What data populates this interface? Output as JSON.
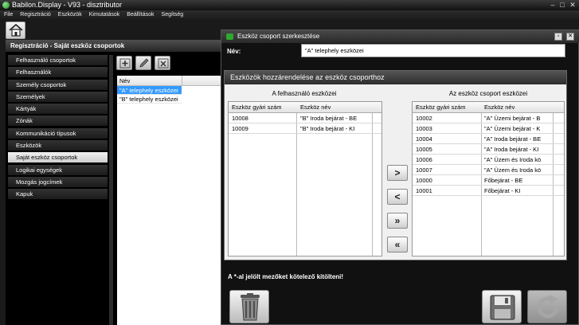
{
  "window": {
    "title": "Babilon.Display - V93 - disztributor",
    "minimize_glyph": "–",
    "maximize_glyph": "□",
    "close_glyph": "✕"
  },
  "menu": [
    "File",
    "Regisztráció",
    "Eszközök",
    "Kimutatások",
    "Beállítások",
    "Segítség"
  ],
  "left_panel": {
    "header": "Regisztráció - Saját eszköz csoportok",
    "items": [
      "Felhasználó csoportok",
      "Felhasználók",
      "Személy csoportok",
      "Személyek",
      "Kártyák",
      "Zónák",
      "Kommunikáció típusok",
      "Eszközök",
      "Saját eszköz csoportok",
      "Logikai egységek",
      "Mozgás jogcímek",
      "Kapuk"
    ],
    "active_item": "Saját eszköz csoportok",
    "toolbar_icons": [
      "add-icon",
      "edit-icon",
      "delete-icon"
    ],
    "table": {
      "header": "Név",
      "rows": [
        "\"A\" telephely eszközei",
        "\"B\" telephely eszközei"
      ],
      "selected_index": 0
    }
  },
  "dialog": {
    "title": "Eszköz csoport szerkesztése",
    "min_glyph": "▫",
    "close_glyph": "✕",
    "name_label": "Név:",
    "name_value": "\"A\" telephely eszközei",
    "assign_title": "Eszközök hozzárendelése az eszköz csoporthoz",
    "left_label": "A felhasználó eszközei",
    "right_label": "Az eszköz csoport eszközei",
    "columns": [
      "Eszköz gyári szám",
      "Eszköz név"
    ],
    "left_rows": [
      {
        "serial": "10008",
        "name": "\"B\" Iroda bejárat - BE"
      },
      {
        "serial": "10009",
        "name": "\"B\" Iroda bejárat - KI"
      }
    ],
    "right_rows": [
      {
        "serial": "10002",
        "name": "\"A\" Üzemi bejárat - B"
      },
      {
        "serial": "10003",
        "name": "\"A\" Üzemi bejárat - K"
      },
      {
        "serial": "10004",
        "name": "\"A\" Iroda bejárat - BE"
      },
      {
        "serial": "10005",
        "name": "\"A\" Iroda bejárat - KI"
      },
      {
        "serial": "10006",
        "name": "\"A\" Üzem és Iroda kö"
      },
      {
        "serial": "10007",
        "name": "\"A\" Üzem és Iroda kö"
      },
      {
        "serial": "10000",
        "name": "Főbejárat - BE"
      },
      {
        "serial": "10001",
        "name": "Főbejárat - KI"
      }
    ],
    "arrow_buttons": [
      ">",
      "<",
      "»",
      "«"
    ],
    "required_note": "A *-al jelölt mezőket kötelező kitölteni!",
    "action_icons": [
      "trash-icon",
      "save-icon",
      "refresh-icon"
    ]
  },
  "colors": {
    "selection": "#3399ff",
    "dark_bg": "#111111",
    "header_gradient_top": "#555555"
  }
}
